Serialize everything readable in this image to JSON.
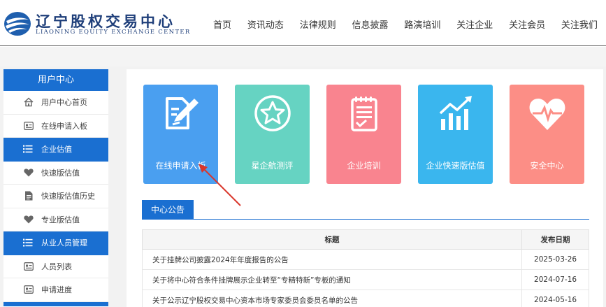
{
  "header": {
    "logo_cn": "辽宁股权交易中心",
    "logo_en": "LIAONING EQUITY EXCHANGE CENTER",
    "nav": [
      "首页",
      "资讯动态",
      "法律规则",
      "信息披露",
      "路演培训",
      "关注企业",
      "关注会员",
      "关注我们"
    ]
  },
  "sidebar": {
    "title": "用户中心",
    "items": [
      {
        "label": "用户中心首页",
        "icon": "home-icon",
        "group": false
      },
      {
        "label": "在线申请入板",
        "icon": "id-card-icon",
        "group": false
      },
      {
        "label": "企业估值",
        "icon": "list-icon",
        "group": true
      },
      {
        "label": "快速版估值",
        "icon": "heart-icon",
        "group": false
      },
      {
        "label": "快速版估值历史",
        "icon": "document-icon",
        "group": false
      },
      {
        "label": "专业版估值",
        "icon": "heart-icon",
        "group": false
      },
      {
        "label": "从业人员管理",
        "icon": "list-icon",
        "group": true
      },
      {
        "label": "人员列表",
        "icon": "id-card-icon",
        "group": false
      },
      {
        "label": "申请进度",
        "icon": "id-card-icon",
        "group": false
      }
    ]
  },
  "cards": [
    {
      "label": "在线申请入板",
      "icon": "edit-document-icon",
      "color": "#4a9ff0"
    },
    {
      "label": "星企航测评",
      "icon": "star-badge-icon",
      "color": "#66d3c2"
    },
    {
      "label": "企业培训",
      "icon": "clipboard-check-icon",
      "color": "#f9848f"
    },
    {
      "label": "企业快速版估值",
      "icon": "growth-chart-icon",
      "color": "#3ab6ee"
    },
    {
      "label": "安全中心",
      "icon": "heartbeat-icon",
      "color": "#fc8e86"
    }
  ],
  "notice": {
    "tab": "中心公告",
    "columns": [
      "标题",
      "发布日期"
    ],
    "rows": [
      {
        "title": "关于挂牌公司披露2024年年度报告的公告",
        "date": "2025-03-26"
      },
      {
        "title": "关于将中心符合条件挂牌展示企业转至“专精特新”专板的通知",
        "date": "2024-07-16"
      },
      {
        "title": "关于公示辽宁股权交易中心资本市场专家委员会委员名单的公告",
        "date": "2024-05-16"
      }
    ]
  },
  "colors": {
    "primary": "#1a6fd1",
    "annotation": "#d9362b"
  }
}
